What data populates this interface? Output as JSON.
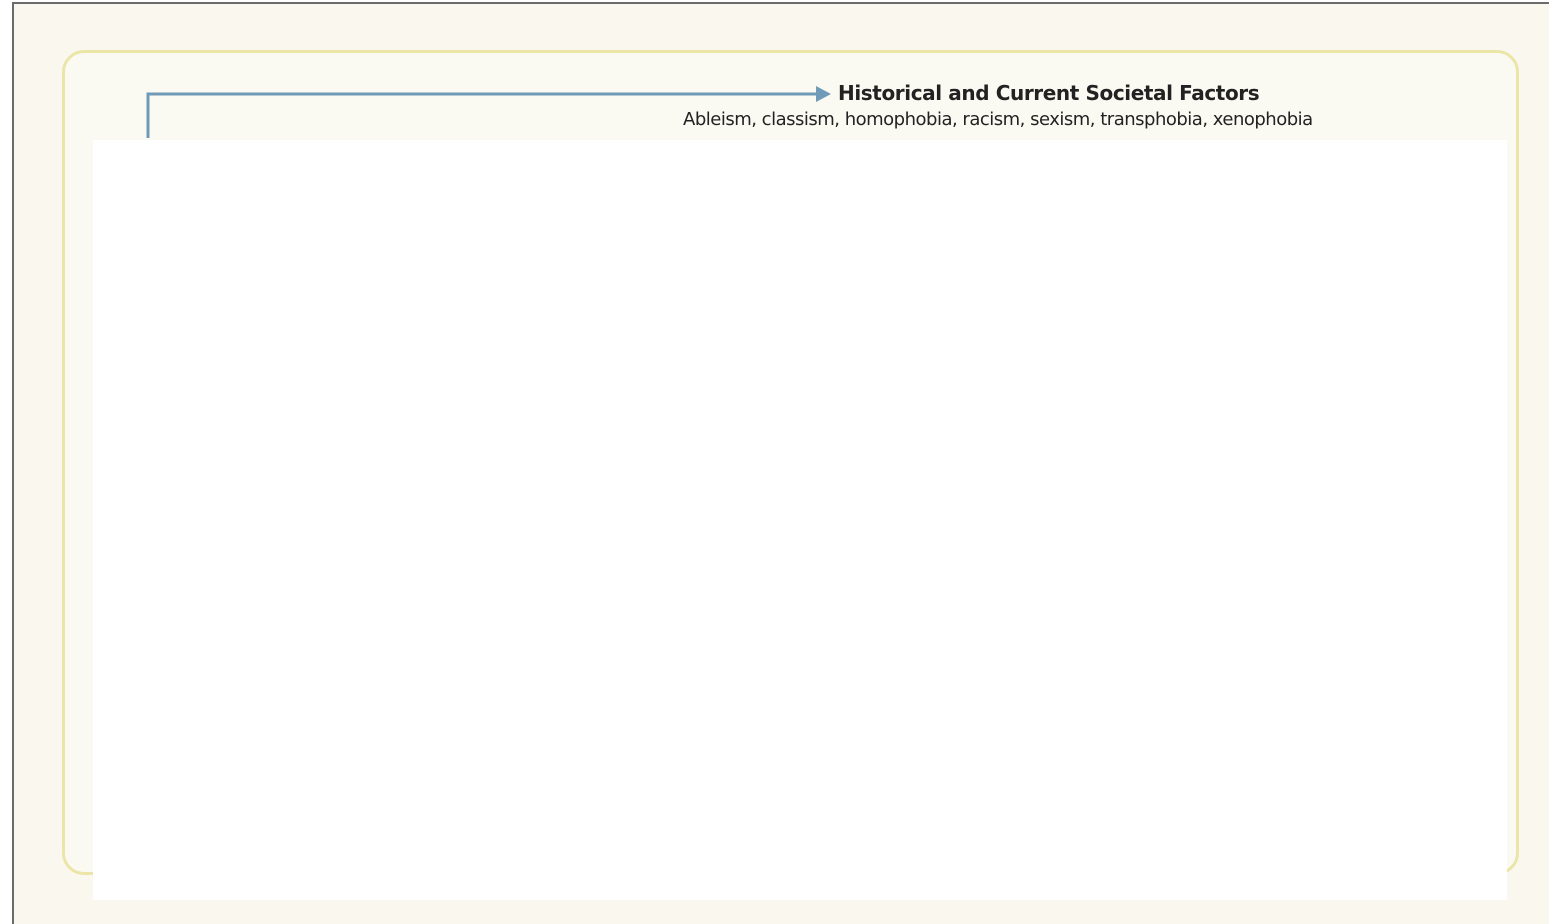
{
  "diagram": {
    "node": {
      "title": "Historical and Current Societal Factors",
      "subtitle": "Ableism, classism, homophobia, racism, sexism, transphobia, xenophobia"
    }
  },
  "colors": {
    "background": "#faf8ee",
    "panel_border": "#ece5a8",
    "connector": "#6f9ab8",
    "text": "#222222"
  }
}
